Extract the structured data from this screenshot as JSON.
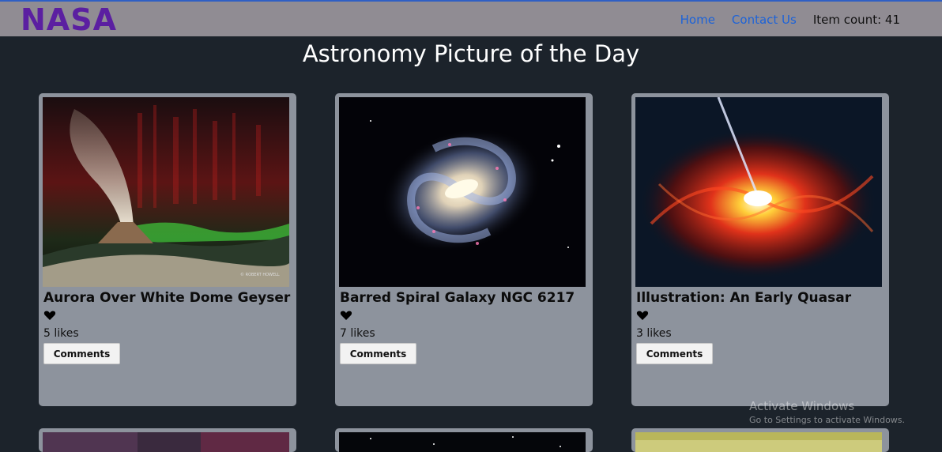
{
  "header": {
    "logo": "NASA",
    "nav": {
      "home": "Home",
      "contact": "Contact Us",
      "item_count": "Item count: 41"
    }
  },
  "page": {
    "title": "Astronomy Picture of the Day"
  },
  "cards": [
    {
      "title": "Aurora Over White Dome Geyser",
      "likes": "5 likes",
      "button": "Comments",
      "image": "aurora-geyser-photo",
      "credit": "© ROBERT HOWELL"
    },
    {
      "title": "Barred Spiral Galaxy NGC 6217",
      "likes": "7 likes",
      "button": "Comments",
      "image": "spiral-galaxy-photo"
    },
    {
      "title": "Illustration: An Early Quasar",
      "likes": "3 likes",
      "button": "Comments",
      "image": "quasar-illustration"
    }
  ],
  "watermark": {
    "line1": "Activate Windows",
    "line2": "Go to Settings to activate Windows."
  },
  "colors": {
    "background": "#1c232b",
    "topbar": "#908c93",
    "logo": "#5b1fa1",
    "link": "#1d63d8",
    "card": "#8d939d"
  }
}
